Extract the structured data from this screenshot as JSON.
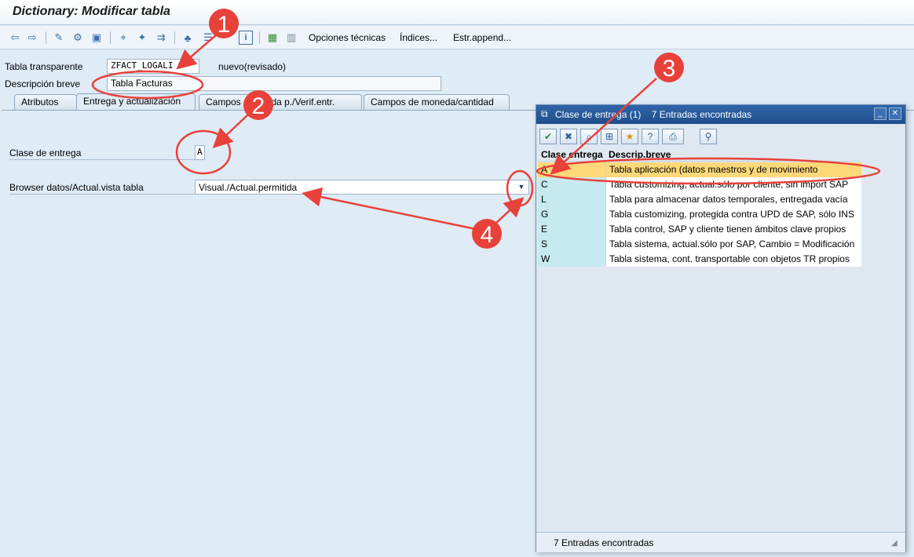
{
  "window": {
    "title": "Dictionary: Modificar tabla"
  },
  "toolbar": {
    "icons": [
      "back-arrow-icon",
      "forward-arrow-icon",
      "display-change-icon",
      "other-object-icon",
      "activate-icon",
      "where-used-icon",
      "object-list-icon",
      "navigation-icon",
      "hierarchy-icon",
      "info-icon",
      "layout-icon",
      "table-grid-icon"
    ],
    "options_label": "Opciones técnicas",
    "indexes_label": "Índices...",
    "append_label": "Estr.append..."
  },
  "header": {
    "table_label": "Tabla transparente",
    "table_value": "ZFACT_LOGALI",
    "status": "nuevo(revisado)",
    "desc_label": "Descripción breve",
    "desc_value": "Tabla Facturas"
  },
  "tabs": [
    "Atributos",
    "Entrega y actualización",
    "Campos",
    "Ayuda p./Verif.entr.",
    "Campos de moneda/cantidad"
  ],
  "form": {
    "delivery_label": "Clase de entrega",
    "delivery_value": "A",
    "browser_label": "Browser datos/Actual.vista tabla",
    "browser_value": "Visual./Actual.permitida"
  },
  "popup": {
    "title": "Clase de entrega (1)",
    "found": "7 Entradas encontradas",
    "col1": "Clase entrega",
    "col2": "Descrip.breve",
    "rows": [
      {
        "code": "A",
        "desc": "Tabla aplicación (datos maestros y de movimiento"
      },
      {
        "code": "C",
        "desc": "Tabla customizing, actual.sólo por cliente, sin import SAP"
      },
      {
        "code": "L",
        "desc": "Tabla para almacenar datos temporales, entregada vacía"
      },
      {
        "code": "G",
        "desc": "Tabla customizing, protegida contra UPD de SAP, sólo INS"
      },
      {
        "code": "E",
        "desc": "Tabla control, SAP y cliente tienen ámbitos clave propios"
      },
      {
        "code": "S",
        "desc": "Tabla sistema, actual.sólo por SAP, Cambio = Modificación"
      },
      {
        "code": "W",
        "desc": "Tabla sistema, cont. transportable con objetos TR propios"
      }
    ],
    "status": "7 Entradas encontradas"
  },
  "annotations": [
    "1",
    "2",
    "3",
    "4"
  ],
  "colors": {
    "annotation_red": "#e8413a",
    "selection": "#ffd879",
    "key_column": "#c7eaf0"
  }
}
